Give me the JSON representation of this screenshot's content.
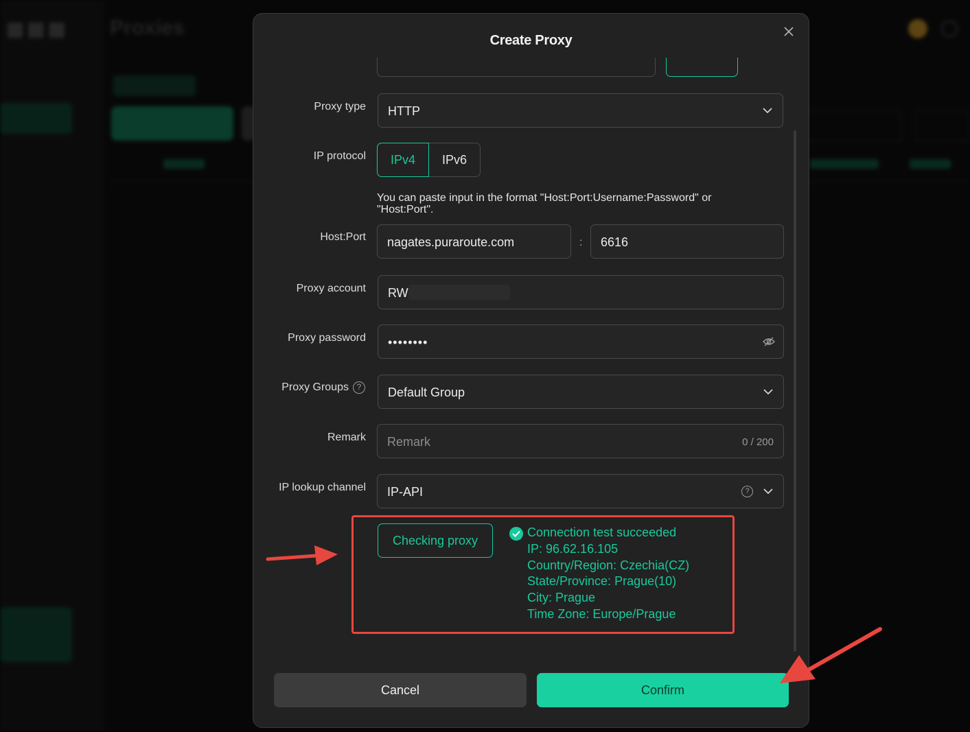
{
  "background": {
    "page_title": "Proxies"
  },
  "modal": {
    "title": "Create Proxy",
    "close_icon": "close-icon",
    "proxy_type": {
      "label": "Proxy type",
      "value": "HTTP"
    },
    "ip_protocol": {
      "label": "IP protocol",
      "options": [
        "IPv4",
        "IPv6"
      ],
      "selected": "IPv4"
    },
    "hint": "You can paste input in the format \"Host:Port:Username:Password\" or \"Host:Port\".",
    "host_port": {
      "label": "Host:Port",
      "host": "nagates.puraroute.com",
      "separator": ":",
      "port": "6616"
    },
    "proxy_account": {
      "label": "Proxy account",
      "value": "RW"
    },
    "proxy_password": {
      "label": "Proxy password",
      "value": "••••••••"
    },
    "proxy_groups": {
      "label": "Proxy Groups",
      "value": "Default Group"
    },
    "remark": {
      "label": "Remark",
      "placeholder": "Remark",
      "counter": "0 / 200"
    },
    "ip_lookup": {
      "label": "IP lookup channel",
      "value": "IP-API"
    },
    "check_button": "Checking proxy",
    "result": {
      "status": "Connection test succeeded",
      "ip": "IP: 96.62.16.105",
      "country": "Country/Region: Czechia(CZ)",
      "state": "State/Province: Prague(10)",
      "city": "City: Prague",
      "timezone": "Time Zone: Europe/Prague"
    },
    "cancel_button": "Cancel",
    "confirm_button": "Confirm"
  },
  "colors": {
    "accent": "#19c99b",
    "confirm_bg": "#19d0a0",
    "annotation": "#e8473f"
  }
}
